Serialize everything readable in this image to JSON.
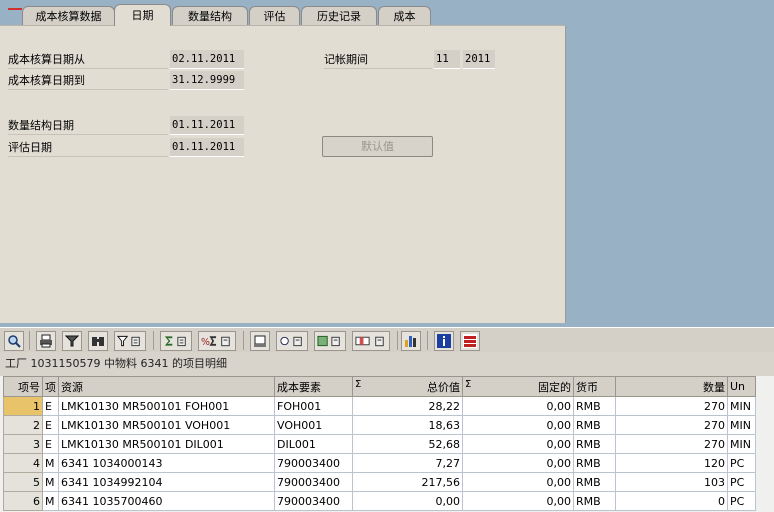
{
  "tabs": [
    "成本核算数据",
    "日期",
    "数量结构",
    "评估",
    "历史记录",
    "成本"
  ],
  "form": {
    "date_from_label": "成本核算日期从",
    "date_from": "02.11.2011",
    "date_to_label": "成本核算日期到",
    "date_to": "31.12.9999",
    "qty_structure_label": "数量结构日期",
    "qty_structure_date": "01.11.2011",
    "valuation_label": "评估日期",
    "valuation_date": "01.11.2011",
    "posting_period_label": "记帐期间",
    "posting_period": "11",
    "posting_year": "2011",
    "default_button": "默认值"
  },
  "toolbar_icons": [
    "zoom-icon",
    "print-icon",
    "filter-icon",
    "binoculars-icon",
    "funnel-icon",
    "sum-icon",
    "subtotal-icon",
    "layout-icon",
    "export-icon",
    "view-icon",
    "graphic-icon",
    "info-icon",
    "abc-icon"
  ],
  "table": {
    "title": "工厂 1031150579 中物料 6341 的项目明细",
    "headers": {
      "item": "项号",
      "type": "项",
      "resource": "资源",
      "cost_element": "成本要素",
      "sigma1": "Σ",
      "total": "总价值",
      "sigma2": "Σ",
      "fixed": "固定的",
      "currency": "货币",
      "quantity": "数量",
      "unit": "Un"
    },
    "rows": [
      {
        "no": "1",
        "type": "E",
        "resource": "LMK10130   MR500101 FOH001",
        "cost_element": "FOH001",
        "total": "28,22",
        "fixed": "0,00",
        "currency": "RMB",
        "quantity": "270",
        "unit": "MIN"
      },
      {
        "no": "2",
        "type": "E",
        "resource": "LMK10130   MR500101 VOH001",
        "cost_element": "VOH001",
        "total": "18,63",
        "fixed": "0,00",
        "currency": "RMB",
        "quantity": "270",
        "unit": "MIN"
      },
      {
        "no": "3",
        "type": "E",
        "resource": "LMK10130   MR500101 DIL001",
        "cost_element": "DIL001",
        "total": "52,68",
        "fixed": "0,00",
        "currency": "RMB",
        "quantity": "270",
        "unit": "MIN"
      },
      {
        "no": "4",
        "type": "M",
        "resource": "6341 1034000143",
        "cost_element": "790003400",
        "total": "7,27",
        "fixed": "0,00",
        "currency": "RMB",
        "quantity": "120",
        "unit": "PC"
      },
      {
        "no": "5",
        "type": "M",
        "resource": "6341 1034992104",
        "cost_element": "790003400",
        "total": "217,56",
        "fixed": "0,00",
        "currency": "RMB",
        "quantity": "103",
        "unit": "PC"
      },
      {
        "no": "6",
        "type": "M",
        "resource": "6341 1035700460",
        "cost_element": "790003400",
        "total": "0,00",
        "fixed": "0,00",
        "currency": "RMB",
        "quantity": "0",
        "unit": "PC"
      }
    ]
  }
}
